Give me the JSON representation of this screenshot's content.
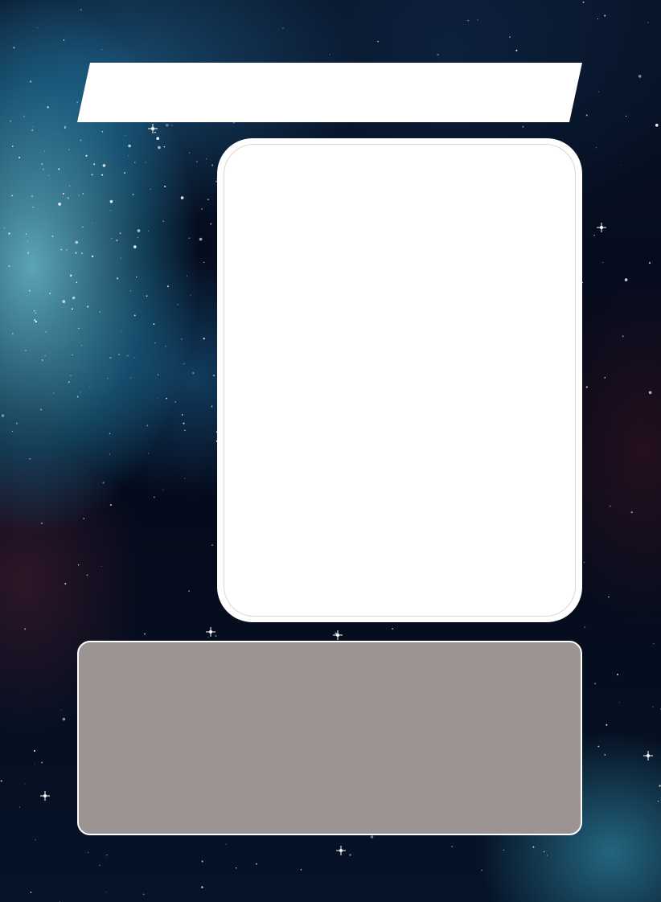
{
  "card": {
    "title": "",
    "body_text": "",
    "colors": {
      "title_banner": "#ffffff",
      "art_frame": "#ffffff",
      "text_box": "#9b9493",
      "text_box_border": "#ffffff",
      "background": "#050a16"
    }
  }
}
